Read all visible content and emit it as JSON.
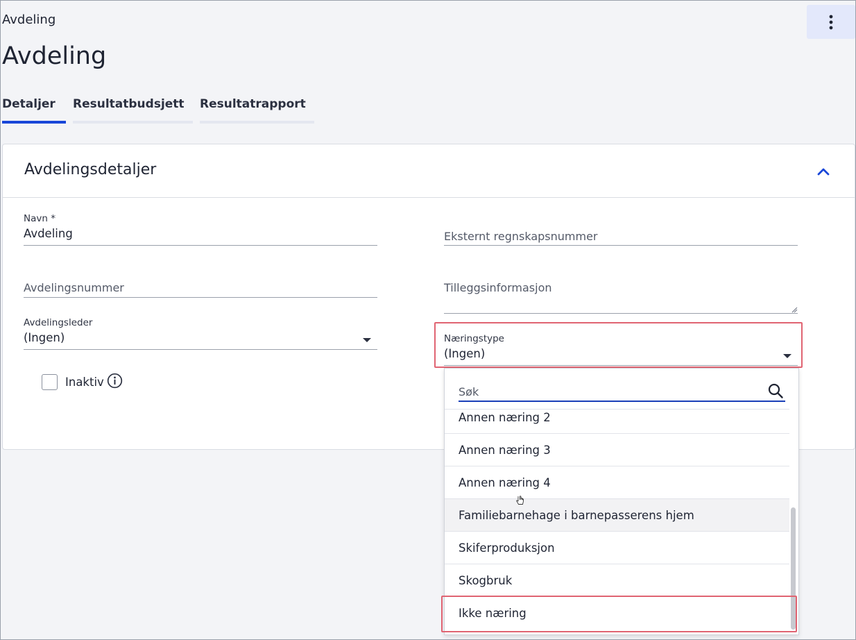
{
  "header": {
    "breadcrumb": "Avdeling",
    "title": "Avdeling",
    "menu_icon": "more-vertical-icon"
  },
  "tabs": [
    {
      "label": "Detaljer",
      "active": true
    },
    {
      "label": "Resultatbudsjett",
      "active": false
    },
    {
      "label": "Resultatrapport",
      "active": false
    }
  ],
  "card": {
    "title": "Avdelingsdetaljer",
    "collapse_icon": "chevron-up-icon"
  },
  "form": {
    "navn": {
      "label": "Navn *",
      "value": "Avdeling"
    },
    "eksternt": {
      "placeholder": "Eksternt regnskapsnummer"
    },
    "avdelingsnummer": {
      "placeholder": "Avdelingsnummer"
    },
    "tillegg": {
      "placeholder": "Tilleggsinformasjon"
    },
    "avdelingsleder": {
      "label": "Avdelingsleder",
      "value": "(Ingen)"
    },
    "naeringstype": {
      "label": "Næringstype",
      "value": "(Ingen)"
    },
    "inaktiv": {
      "label": "Inaktiv",
      "checked": false
    }
  },
  "dropdown": {
    "search_placeholder": "Søk",
    "items": [
      "Annen næring 2",
      "Annen næring 3",
      "Annen næring 4",
      "Familiebarnehage i barnepasserens hjem",
      "Skiferproduksjon",
      "Skogbruk",
      "Ikke næring"
    ]
  },
  "colors": {
    "accent": "#1846d8",
    "highlight": "#e06472"
  }
}
